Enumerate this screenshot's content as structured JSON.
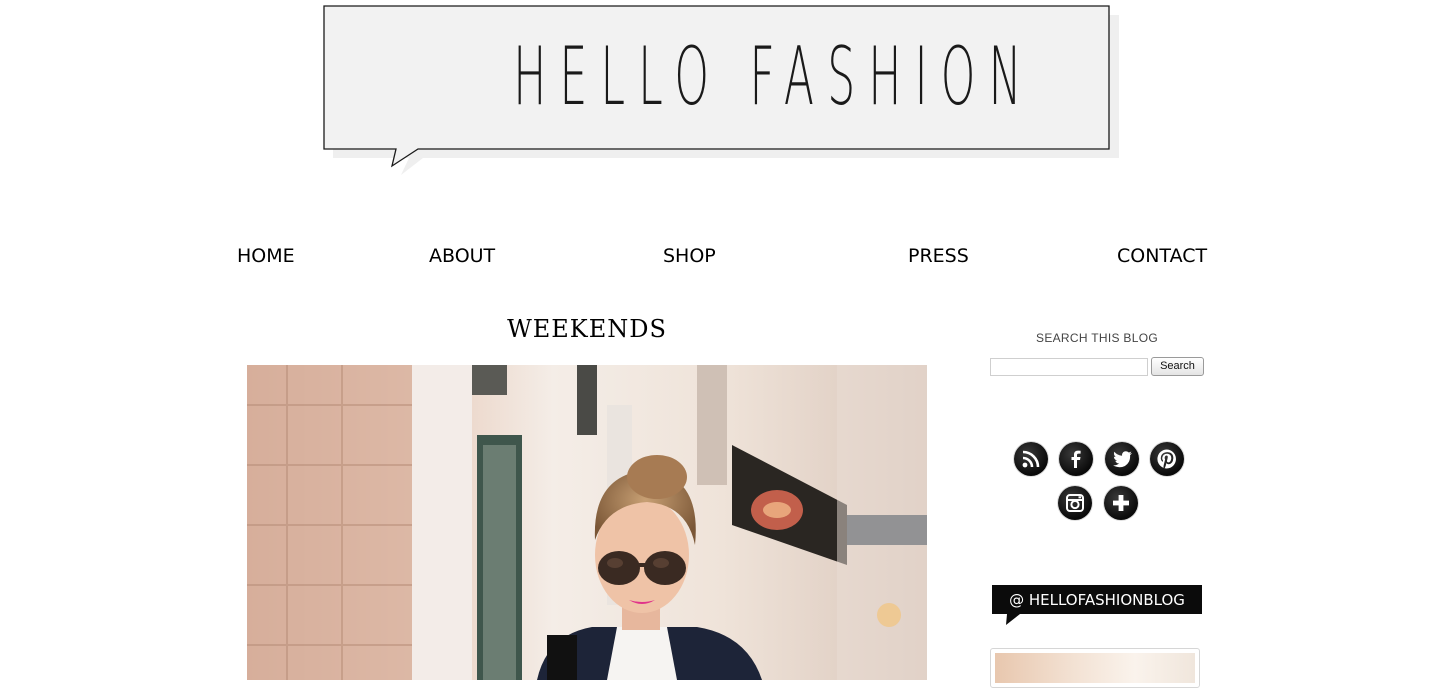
{
  "header": {
    "logo_text": "HELLO FASHION"
  },
  "nav": {
    "items": [
      {
        "label": "HOME"
      },
      {
        "label": "ABOUT"
      },
      {
        "label": "SHOP"
      },
      {
        "label": "PRESS"
      },
      {
        "label": "CONTACT"
      }
    ]
  },
  "post": {
    "title": "WEEKENDS"
  },
  "sidebar": {
    "search_heading": "SEARCH THIS BLOG",
    "search_value": "",
    "search_button": "Search",
    "social_icons": [
      "rss-icon",
      "facebook-icon",
      "twitter-icon",
      "pinterest-icon",
      "instagram-icon",
      "plus-icon"
    ],
    "instagram_banner": "@ HELLOFASHIONBLOG"
  },
  "colors": {
    "logo_fill": "#f2f2f2",
    "text": "#000000",
    "social_bg": "#111111"
  }
}
